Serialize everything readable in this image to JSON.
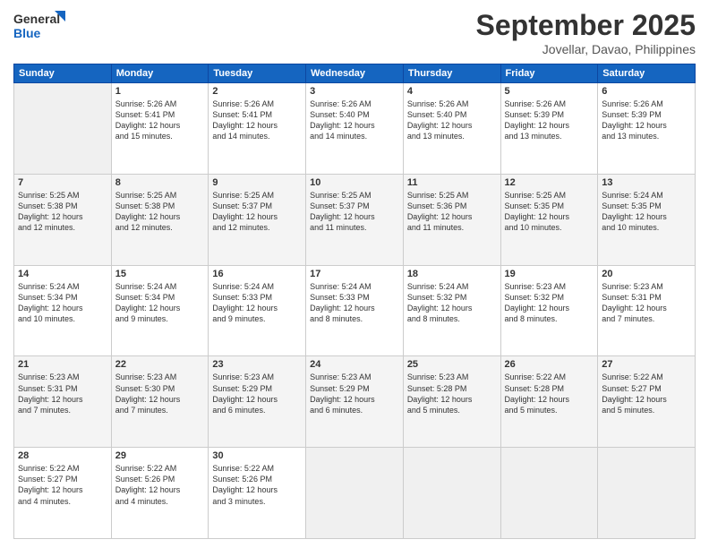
{
  "logo": {
    "line1": "General",
    "line2": "Blue"
  },
  "title": "September 2025",
  "location": "Jovellar, Davao, Philippines",
  "weekdays": [
    "Sunday",
    "Monday",
    "Tuesday",
    "Wednesday",
    "Thursday",
    "Friday",
    "Saturday"
  ],
  "weeks": [
    [
      {
        "day": "",
        "info": ""
      },
      {
        "day": "1",
        "info": "Sunrise: 5:26 AM\nSunset: 5:41 PM\nDaylight: 12 hours\nand 15 minutes."
      },
      {
        "day": "2",
        "info": "Sunrise: 5:26 AM\nSunset: 5:41 PM\nDaylight: 12 hours\nand 14 minutes."
      },
      {
        "day": "3",
        "info": "Sunrise: 5:26 AM\nSunset: 5:40 PM\nDaylight: 12 hours\nand 14 minutes."
      },
      {
        "day": "4",
        "info": "Sunrise: 5:26 AM\nSunset: 5:40 PM\nDaylight: 12 hours\nand 13 minutes."
      },
      {
        "day": "5",
        "info": "Sunrise: 5:26 AM\nSunset: 5:39 PM\nDaylight: 12 hours\nand 13 minutes."
      },
      {
        "day": "6",
        "info": "Sunrise: 5:26 AM\nSunset: 5:39 PM\nDaylight: 12 hours\nand 13 minutes."
      }
    ],
    [
      {
        "day": "7",
        "info": "Sunrise: 5:25 AM\nSunset: 5:38 PM\nDaylight: 12 hours\nand 12 minutes."
      },
      {
        "day": "8",
        "info": "Sunrise: 5:25 AM\nSunset: 5:38 PM\nDaylight: 12 hours\nand 12 minutes."
      },
      {
        "day": "9",
        "info": "Sunrise: 5:25 AM\nSunset: 5:37 PM\nDaylight: 12 hours\nand 12 minutes."
      },
      {
        "day": "10",
        "info": "Sunrise: 5:25 AM\nSunset: 5:37 PM\nDaylight: 12 hours\nand 11 minutes."
      },
      {
        "day": "11",
        "info": "Sunrise: 5:25 AM\nSunset: 5:36 PM\nDaylight: 12 hours\nand 11 minutes."
      },
      {
        "day": "12",
        "info": "Sunrise: 5:25 AM\nSunset: 5:35 PM\nDaylight: 12 hours\nand 10 minutes."
      },
      {
        "day": "13",
        "info": "Sunrise: 5:24 AM\nSunset: 5:35 PM\nDaylight: 12 hours\nand 10 minutes."
      }
    ],
    [
      {
        "day": "14",
        "info": "Sunrise: 5:24 AM\nSunset: 5:34 PM\nDaylight: 12 hours\nand 10 minutes."
      },
      {
        "day": "15",
        "info": "Sunrise: 5:24 AM\nSunset: 5:34 PM\nDaylight: 12 hours\nand 9 minutes."
      },
      {
        "day": "16",
        "info": "Sunrise: 5:24 AM\nSunset: 5:33 PM\nDaylight: 12 hours\nand 9 minutes."
      },
      {
        "day": "17",
        "info": "Sunrise: 5:24 AM\nSunset: 5:33 PM\nDaylight: 12 hours\nand 8 minutes."
      },
      {
        "day": "18",
        "info": "Sunrise: 5:24 AM\nSunset: 5:32 PM\nDaylight: 12 hours\nand 8 minutes."
      },
      {
        "day": "19",
        "info": "Sunrise: 5:23 AM\nSunset: 5:32 PM\nDaylight: 12 hours\nand 8 minutes."
      },
      {
        "day": "20",
        "info": "Sunrise: 5:23 AM\nSunset: 5:31 PM\nDaylight: 12 hours\nand 7 minutes."
      }
    ],
    [
      {
        "day": "21",
        "info": "Sunrise: 5:23 AM\nSunset: 5:31 PM\nDaylight: 12 hours\nand 7 minutes."
      },
      {
        "day": "22",
        "info": "Sunrise: 5:23 AM\nSunset: 5:30 PM\nDaylight: 12 hours\nand 7 minutes."
      },
      {
        "day": "23",
        "info": "Sunrise: 5:23 AM\nSunset: 5:29 PM\nDaylight: 12 hours\nand 6 minutes."
      },
      {
        "day": "24",
        "info": "Sunrise: 5:23 AM\nSunset: 5:29 PM\nDaylight: 12 hours\nand 6 minutes."
      },
      {
        "day": "25",
        "info": "Sunrise: 5:23 AM\nSunset: 5:28 PM\nDaylight: 12 hours\nand 5 minutes."
      },
      {
        "day": "26",
        "info": "Sunrise: 5:22 AM\nSunset: 5:28 PM\nDaylight: 12 hours\nand 5 minutes."
      },
      {
        "day": "27",
        "info": "Sunrise: 5:22 AM\nSunset: 5:27 PM\nDaylight: 12 hours\nand 5 minutes."
      }
    ],
    [
      {
        "day": "28",
        "info": "Sunrise: 5:22 AM\nSunset: 5:27 PM\nDaylight: 12 hours\nand 4 minutes."
      },
      {
        "day": "29",
        "info": "Sunrise: 5:22 AM\nSunset: 5:26 PM\nDaylight: 12 hours\nand 4 minutes."
      },
      {
        "day": "30",
        "info": "Sunrise: 5:22 AM\nSunset: 5:26 PM\nDaylight: 12 hours\nand 3 minutes."
      },
      {
        "day": "",
        "info": ""
      },
      {
        "day": "",
        "info": ""
      },
      {
        "day": "",
        "info": ""
      },
      {
        "day": "",
        "info": ""
      }
    ]
  ]
}
